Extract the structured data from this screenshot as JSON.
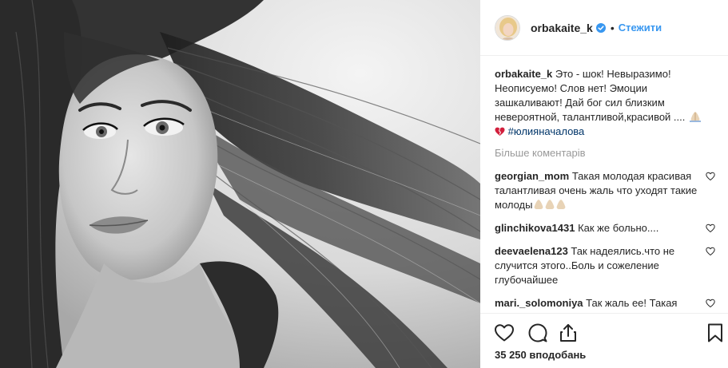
{
  "post": {
    "image_alt": "Black and white portrait",
    "author": {
      "username": "orbakaite_k",
      "verified": true,
      "separator": "•",
      "follow_label": "Стежити"
    },
    "caption": {
      "username": "orbakaite_k",
      "text": "Это - шок! Невыразимо! Неописуемо! Слов нет! Эмоции зашкаливают! Дай бог сил близким невероятной, талантливой,красивой ....",
      "hashtag": "#юлияначалова"
    },
    "load_more_label": "Більше коментарів",
    "comments": [
      {
        "username": "georgian_mom",
        "text": "Такая молодая красивая талантливая очень жаль что уходят такие молоды"
      },
      {
        "username": "glinchikova1431",
        "text": "Как же больно...."
      },
      {
        "username": "deevaelena123",
        "text": "Так надеялись.что не случится этого..Боль и сожеление глубочайшее"
      },
      {
        "username": "mari._solomoniya",
        "text": "Так жаль ее! Такая молодая! Такая красивая!........"
      }
    ],
    "likes_label": "35 250 вподобань"
  },
  "icons": {
    "verified": "verified-badge-icon",
    "like": "heart-outline-icon",
    "comment": "comment-bubble-icon",
    "share": "share-upload-icon",
    "save": "bookmark-icon",
    "comment_like": "small-heart-icon",
    "praying": "folded-hands-emoji",
    "broken_heart": "broken-heart-emoji"
  },
  "colors": {
    "link": "#3897f0",
    "hashtag": "#003569",
    "muted": "#999999",
    "text": "#262626",
    "border": "#efefef"
  }
}
